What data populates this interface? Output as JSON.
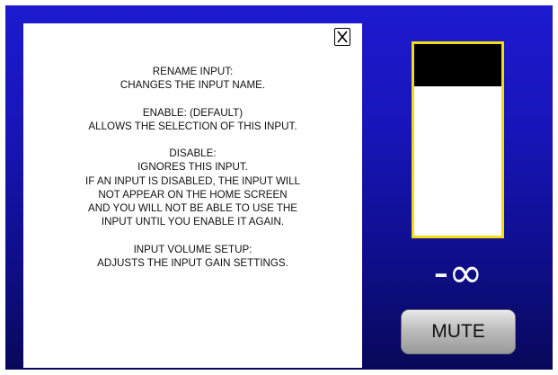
{
  "help": {
    "close_label": "X",
    "paragraphs": [
      [
        "RENAME INPUT:",
        "CHANGES THE INPUT NAME."
      ],
      [
        "ENABLE: (DEFAULT)",
        "ALLOWS THE SELECTION OF THIS INPUT."
      ],
      [
        "DISABLE:",
        "IGNORES THIS INPUT.",
        "IF AN INPUT IS DISABLED, THE INPUT WILL",
        "NOT APPEAR ON THE HOME SCREEN",
        "AND YOU WILL NOT BE ABLE TO USE THE",
        "INPUT UNTIL YOU ENABLE IT AGAIN."
      ],
      [
        "INPUT VOLUME SETUP:",
        "ADJUSTS THE INPUT GAIN SETTINGS."
      ]
    ]
  },
  "volume": {
    "readout": "-∞",
    "meter_level_fraction": 0.22
  },
  "mute_label": "MUTE",
  "colors": {
    "background_top": "#1d1ad0",
    "background_bottom": "#08085a",
    "meter_border": "#f2dc10",
    "meter_fill": "#000000",
    "panel": "#ffffff"
  }
}
